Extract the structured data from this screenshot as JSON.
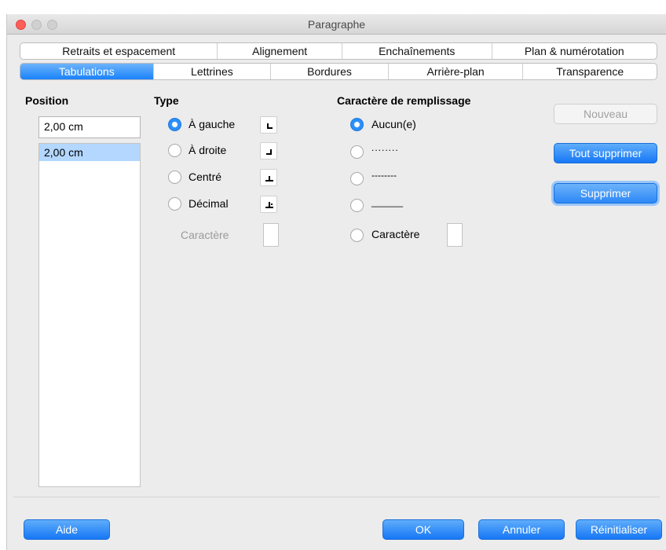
{
  "window": {
    "title": "Paragraphe"
  },
  "tabs_row1": [
    "Retraits et espacement",
    "Alignement",
    "Enchaînements",
    "Plan & numérotation"
  ],
  "tabs_row2": [
    "Tabulations",
    "Lettrines",
    "Bordures",
    "Arrière-plan",
    "Transparence"
  ],
  "active_tab": "Tabulations",
  "position": {
    "heading": "Position",
    "input_value": "2,00 cm",
    "list": [
      "2,00 cm"
    ]
  },
  "type": {
    "heading": "Type",
    "options": [
      "À gauche",
      "À droite",
      "Centré",
      "Décimal"
    ],
    "selected": "À gauche",
    "character_label": "Caractère",
    "icons": [
      "tab-left-icon",
      "tab-right-icon",
      "tab-center-icon",
      "tab-decimal-icon"
    ]
  },
  "fill": {
    "heading": "Caractère de remplissage",
    "options": [
      "Aucun(e)",
      "........",
      "--------",
      "______",
      "Caractère"
    ],
    "selected": "Aucun(e)"
  },
  "buttons": {
    "new": "Nouveau",
    "delete_all": "Tout supprimer",
    "delete": "Supprimer",
    "help": "Aide",
    "ok": "OK",
    "cancel": "Annuler",
    "reset": "Réinitialiser"
  },
  "colors": {
    "accent": "#1a82fb",
    "close": "#fc5f57",
    "selection": "#b3d7ff"
  }
}
